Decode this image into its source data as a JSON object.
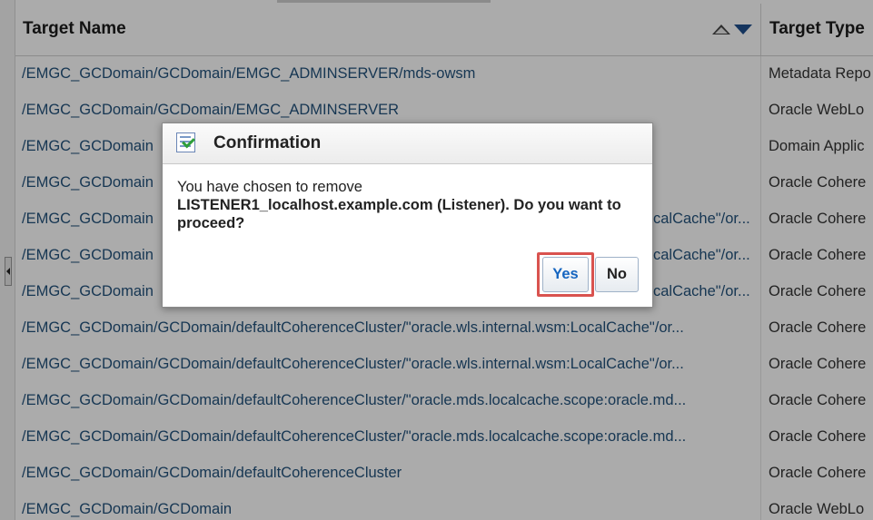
{
  "table": {
    "columns": [
      "Target Name",
      "Target Type"
    ],
    "rows": [
      {
        "name": "/EMGC_GCDomain/GCDomain/EMGC_ADMINSERVER/mds-owsm",
        "type": "Metadata Repo"
      },
      {
        "name": "/EMGC_GCDomain/GCDomain/EMGC_ADMINSERVER",
        "type": "Oracle WebLo"
      },
      {
        "name": "/EMGC_GCDomain",
        "type": "Domain Applic"
      },
      {
        "name": "/EMGC_GCDomain",
        "type": "Oracle Cohere"
      },
      {
        "name": "/EMGC_GCDomain",
        "type": "Oracle Cohere"
      },
      {
        "name": "/EMGC_GCDomain",
        "type": "Oracle Cohere"
      },
      {
        "name": "/EMGC_GCDomain",
        "type": "Oracle Cohere"
      },
      {
        "name": "/EMGC_GCDomain/GCDomain/defaultCoherenceCluster/\"oracle.wls.internal.wsm:LocalCache\"/or...",
        "type": "Oracle Cohere"
      },
      {
        "name": "/EMGC_GCDomain/GCDomain/defaultCoherenceCluster/\"oracle.wls.internal.wsm:LocalCache\"/or...",
        "type": "Oracle Cohere"
      },
      {
        "name": "/EMGC_GCDomain/GCDomain/defaultCoherenceCluster/\"oracle.mds.localcache.scope:oracle.md...",
        "type": "Oracle Cohere"
      },
      {
        "name": "/EMGC_GCDomain/GCDomain/defaultCoherenceCluster/\"oracle.mds.localcache.scope:oracle.md...",
        "type": "Oracle Cohere"
      },
      {
        "name": "/EMGC_GCDomain/GCDomain/defaultCoherenceCluster",
        "type": "Oracle Cohere"
      },
      {
        "name": "/EMGC_GCDomain/GCDomain",
        "type": "Oracle WebLo"
      }
    ],
    "peek_right": {
      "4": "calCache\"/or...",
      "5": "calCache\"/or...",
      "6": "calCache\"/or..."
    }
  },
  "dialog": {
    "title": "Confirmation",
    "message_lead": "You have chosen to remove",
    "message_body": "LISTENER1_localhost.example.com (Listener). Do you want to proceed?",
    "yes_label": "Yes",
    "no_label": "No"
  },
  "colors": {
    "link": "#23527c",
    "highlight": "#d9534f",
    "yes_text": "#1565c0"
  }
}
